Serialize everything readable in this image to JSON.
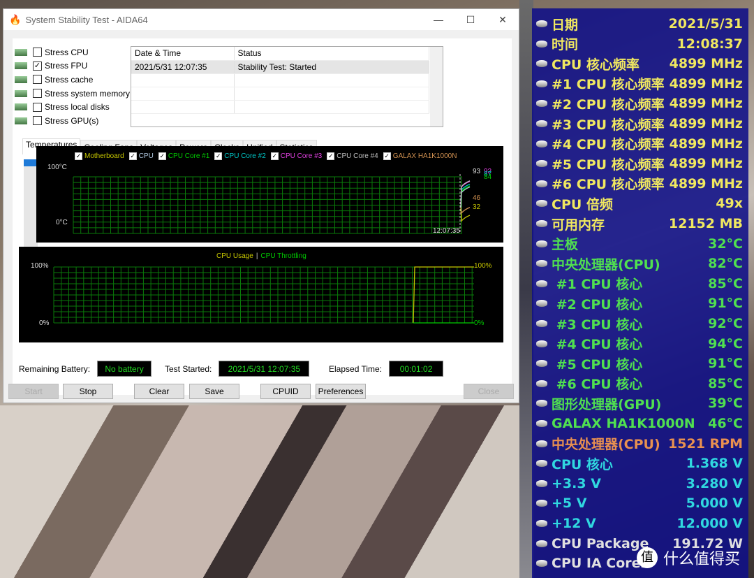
{
  "window": {
    "title": "System Stability Test - AIDA64",
    "minimize": "—",
    "maximize": "☐",
    "close": "✕"
  },
  "stress": [
    {
      "label": "Stress CPU",
      "checked": false,
      "icon": "cpu-chip-icon"
    },
    {
      "label": "Stress FPU",
      "checked": true,
      "icon": "fpu-icon"
    },
    {
      "label": "Stress cache",
      "checked": false,
      "icon": "cache-icon"
    },
    {
      "label": "Stress system memory",
      "checked": false,
      "icon": "memory-icon"
    },
    {
      "label": "Stress local disks",
      "checked": false,
      "icon": "disk-icon"
    },
    {
      "label": "Stress GPU(s)",
      "checked": false,
      "icon": "gpu-icon"
    }
  ],
  "log": {
    "headers": [
      "Date & Time",
      "Status"
    ],
    "rows": [
      [
        "2021/5/31 12:07:35",
        "Stability Test: Started"
      ]
    ]
  },
  "tabs": [
    "Temperatures",
    "Cooling Fans",
    "Voltages",
    "Powers",
    "Clocks",
    "Unified",
    "Statistics"
  ],
  "chart_data": [
    {
      "type": "line",
      "legend": [
        {
          "name": "Motherboard",
          "color": "#c8c800"
        },
        {
          "name": "CPU",
          "color": "#b0c8e0"
        },
        {
          "name": "CPU Core #1",
          "color": "#00cc00"
        },
        {
          "name": "CPU Core #2",
          "color": "#00c8c8"
        },
        {
          "name": "CPU Core #3",
          "color": "#e040e0"
        },
        {
          "name": "CPU Core #4",
          "color": "#c0c0c0"
        },
        {
          "name": "GALAX HA1K1000N",
          "color": "#d09050"
        }
      ],
      "y_top": "100°C",
      "y_bottom": "0°C",
      "ylim": [
        0,
        100
      ],
      "x_label": "12:07:35",
      "end_labels": [
        {
          "v": "93",
          "color": "#e0e0e0"
        },
        {
          "v": "92",
          "color": "#e040e0"
        },
        {
          "v": "87",
          "color": "#00c8c8"
        },
        {
          "v": "84",
          "color": "#00cc00"
        },
        {
          "v": "46",
          "color": "#d09050"
        },
        {
          "v": "32",
          "color": "#c8c800"
        }
      ],
      "final_values": [
        32,
        82,
        84,
        87,
        92,
        93,
        46
      ]
    },
    {
      "type": "line",
      "legend": [
        {
          "name": "CPU Usage",
          "color": "#c8c800"
        },
        {
          "name": "CPU Throttling",
          "color": "#00cc00"
        }
      ],
      "separator": "|",
      "y_left_top": "100%",
      "y_left_bottom": "0%",
      "y_right_top": "100%",
      "y_right_bottom": "0%",
      "ylim": [
        0,
        100
      ],
      "series": [
        {
          "name": "CPU Usage",
          "values_end": 100
        },
        {
          "name": "CPU Throttling",
          "values_end": 0
        }
      ]
    }
  ],
  "status": {
    "battery_label": "Remaining Battery:",
    "battery": "No battery",
    "started_label": "Test Started:",
    "started": "2021/5/31 12:07:35",
    "elapsed_label": "Elapsed Time:",
    "elapsed": "00:01:02"
  },
  "buttons": {
    "start": "Start",
    "stop": "Stop",
    "clear": "Clear",
    "save": "Save",
    "cpuid": "CPUID",
    "preferences": "Preferences",
    "close": "Close"
  },
  "osd": [
    {
      "label": "日期",
      "value": "2021/5/31",
      "color": "#f0e860",
      "icon": "calendar-icon"
    },
    {
      "label": "时间",
      "value": "12:08:37",
      "color": "#f0e860",
      "icon": "clock-icon"
    },
    {
      "label": "CPU 核心频率",
      "value": "4899 MHz",
      "color": "#f0e860",
      "icon": "cpu-icon"
    },
    {
      "label": "#1 CPU 核心频率",
      "value": "4899 MHz",
      "color": "#f0e860",
      "icon": "cpu-icon"
    },
    {
      "label": "#2 CPU 核心频率",
      "value": "4899 MHz",
      "color": "#f0e860",
      "icon": "cpu-icon"
    },
    {
      "label": "#3 CPU 核心频率",
      "value": "4899 MHz",
      "color": "#f0e860",
      "icon": "cpu-icon"
    },
    {
      "label": "#4 CPU 核心频率",
      "value": "4899 MHz",
      "color": "#f0e860",
      "icon": "cpu-icon"
    },
    {
      "label": "#5 CPU 核心频率",
      "value": "4899 MHz",
      "color": "#f0e860",
      "icon": "cpu-icon"
    },
    {
      "label": "#6 CPU 核心频率",
      "value": "4899 MHz",
      "color": "#f0e860",
      "icon": "cpu-icon"
    },
    {
      "label": "CPU 倍频",
      "value": "49x",
      "color": "#f0e860",
      "icon": "cpu-icon"
    },
    {
      "label": "可用内存",
      "value": "12152 MB",
      "color": "#f0e860",
      "icon": "memory-icon"
    },
    {
      "label": "主板",
      "value": "32°C",
      "color": "#50e050",
      "icon": "motherboard-icon"
    },
    {
      "label": "中央处理器(CPU)",
      "value": "82°C",
      "color": "#50e050",
      "icon": "cpu-icon"
    },
    {
      "label": " #1 CPU 核心",
      "value": "85°C",
      "color": "#50e050",
      "icon": "cpu-icon"
    },
    {
      "label": " #2 CPU 核心",
      "value": "91°C",
      "color": "#50e050",
      "icon": "cpu-icon"
    },
    {
      "label": " #3 CPU 核心",
      "value": "92°C",
      "color": "#50e050",
      "icon": "cpu-icon"
    },
    {
      "label": " #4 CPU 核心",
      "value": "94°C",
      "color": "#50e050",
      "icon": "cpu-icon"
    },
    {
      "label": " #5 CPU 核心",
      "value": "91°C",
      "color": "#50e050",
      "icon": "cpu-icon"
    },
    {
      "label": " #6 CPU 核心",
      "value": "85°C",
      "color": "#50e050",
      "icon": "cpu-icon"
    },
    {
      "label": "图形处理器(GPU)",
      "value": "39°C",
      "color": "#50e050",
      "icon": "gpu-icon"
    },
    {
      "label": "GALAX HA1K1000N",
      "value": "46°C",
      "color": "#50e050",
      "icon": "disk-icon"
    },
    {
      "label": "中央处理器(CPU)",
      "value": "1521 RPM",
      "color": "#e89050",
      "icon": "fan-icon"
    },
    {
      "label": "CPU 核心",
      "value": "1.368 V",
      "color": "#30d8e0",
      "icon": "cpu-icon"
    },
    {
      "label": "+3.3 V",
      "value": "3.280 V",
      "color": "#30d8e0",
      "icon": "voltage-icon"
    },
    {
      "label": "+5 V",
      "value": "5.000 V",
      "color": "#30d8e0",
      "icon": "voltage-icon"
    },
    {
      "label": "+12 V",
      "value": "12.000 V",
      "color": "#30d8e0",
      "icon": "voltage-icon"
    },
    {
      "label": "CPU Package",
      "value": "191.72 W",
      "color": "#e0e0e0",
      "icon": "cpu-icon"
    },
    {
      "label": "CPU IA Cores",
      "value": "",
      "color": "#e0e0e0",
      "icon": "cpu-icon"
    }
  ],
  "watermark": {
    "logo": "值",
    "text": "什么值得买"
  }
}
